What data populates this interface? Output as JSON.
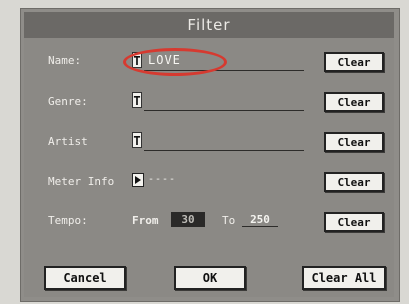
{
  "dialog": {
    "title": "Filter"
  },
  "rows": {
    "name": {
      "label": "Name:",
      "value": "LOVE",
      "clear_label": "Clear"
    },
    "genre": {
      "label": "Genre:",
      "value": "",
      "clear_label": "Clear"
    },
    "artist": {
      "label": "Artist",
      "value": "",
      "clear_label": "Clear"
    },
    "meter": {
      "label": "Meter Info",
      "value": "----",
      "clear_label": "Clear"
    },
    "tempo": {
      "label": "Tempo:",
      "from_label": "From",
      "from_value": "30",
      "to_label": "To",
      "to_value": "250",
      "clear_label": "Clear"
    }
  },
  "cursor_glyph": "T",
  "buttons": {
    "cancel": "Cancel",
    "ok": "OK",
    "clear_all": "Clear All"
  },
  "colors": {
    "highlight": "#d63a30",
    "panel": "#8b8985",
    "title_bar": "#6b6966"
  }
}
